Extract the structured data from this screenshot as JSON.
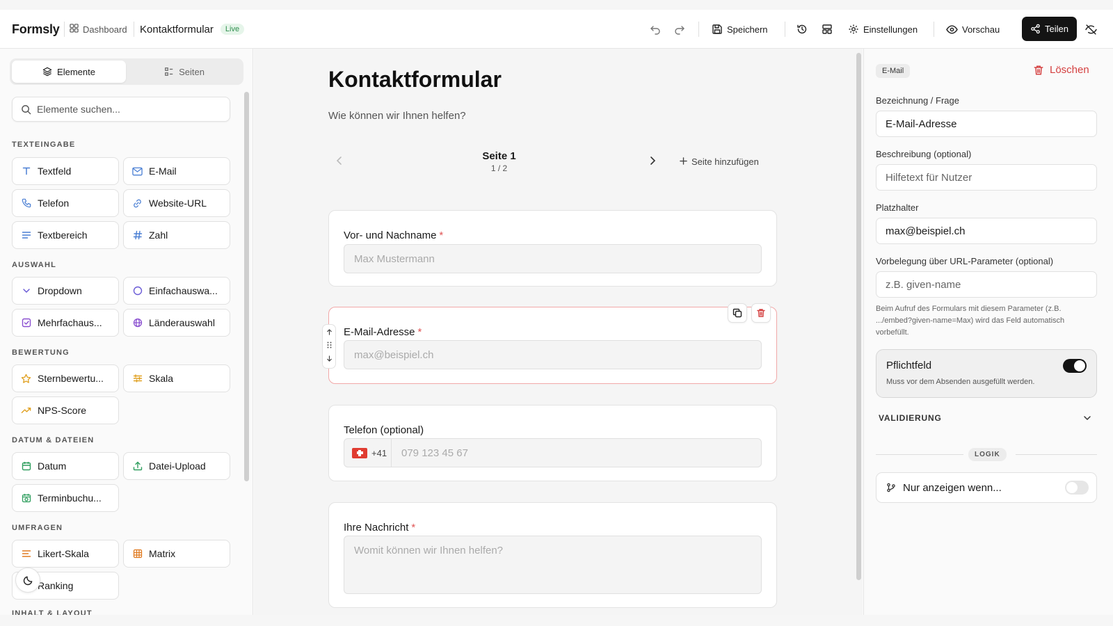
{
  "app": {
    "logo": "Formsly",
    "breadcrumb": "Dashboard",
    "form_name": "Kontaktformular",
    "status_badge": "Live",
    "save_label": "Speichern",
    "settings_label": "Einstellungen",
    "preview_label": "Vorschau",
    "share_label": "Teilen"
  },
  "sidebar": {
    "tabs": [
      {
        "label": "Elemente"
      },
      {
        "label": "Seiten"
      }
    ],
    "search_placeholder": "Elemente suchen...",
    "categories": [
      {
        "title": "TEXTEINGABE",
        "items": [
          {
            "label": "Textfeld",
            "icon": "text-icon"
          },
          {
            "label": "E-Mail",
            "icon": "mail-icon"
          },
          {
            "label": "Telefon",
            "icon": "phone-icon"
          },
          {
            "label": "Website-URL",
            "icon": "link-icon"
          },
          {
            "label": "Textbereich",
            "icon": "lines-icon"
          },
          {
            "label": "Zahl",
            "icon": "hash-icon"
          }
        ]
      },
      {
        "title": "AUSWAHL",
        "items": [
          {
            "label": "Dropdown",
            "icon": "chevron-down-icon"
          },
          {
            "label": "Einfachauswa...",
            "icon": "radio-icon"
          },
          {
            "label": "Mehrfachaus...",
            "icon": "checkbox-icon"
          },
          {
            "label": "Länderauswahl",
            "icon": "globe-icon"
          }
        ]
      },
      {
        "title": "BEWERTUNG",
        "items": [
          {
            "label": "Sternbewertu...",
            "icon": "star-icon"
          },
          {
            "label": "Skala",
            "icon": "sliders-icon"
          },
          {
            "label": "NPS-Score",
            "icon": "trend-icon"
          }
        ]
      },
      {
        "title": "DATUM & DATEIEN",
        "items": [
          {
            "label": "Datum",
            "icon": "calendar-icon"
          },
          {
            "label": "Datei-Upload",
            "icon": "upload-icon"
          },
          {
            "label": "Terminbuchu...",
            "icon": "calendar-clock-icon"
          }
        ]
      },
      {
        "title": "UMFRAGEN",
        "items": [
          {
            "label": "Likert-Skala",
            "icon": "list-icon"
          },
          {
            "label": "Matrix",
            "icon": "grid-icon"
          },
          {
            "label": "Ranking",
            "icon": "ranking-icon"
          }
        ]
      },
      {
        "title": "INHALT & LAYOUT",
        "items": []
      }
    ]
  },
  "canvas": {
    "title": "Kontaktformular",
    "subtitle": "Wie können wir Ihnen helfen?",
    "page_label": "Seite 1",
    "page_count": "1 / 2",
    "add_page": "Seite hinzufügen",
    "fields": [
      {
        "label": "Vor- und Nachname",
        "required": "*",
        "placeholder": "Max Mustermann"
      },
      {
        "label": "E-Mail-Adresse",
        "required": "*",
        "placeholder": "max@beispiel.ch"
      },
      {
        "label": "Telefon (optional)",
        "required": "",
        "prefix": "+41",
        "placeholder": "079 123 45 67"
      },
      {
        "label": "Ihre Nachricht",
        "required": "*",
        "placeholder": "Womit können wir Ihnen helfen?"
      }
    ]
  },
  "panel": {
    "type_chip": "E-Mail",
    "delete_label": "Löschen",
    "label_label": "Bezeichnung / Frage",
    "label_value": "E-Mail-Adresse",
    "desc_label": "Beschreibung (optional)",
    "desc_placeholder": "Hilfetext für Nutzer",
    "ph_label": "Platzhalter",
    "ph_value": "max@beispiel.ch",
    "prefill_label": "Vorbelegung über URL-Parameter (optional)",
    "prefill_placeholder": "z.B. given-name",
    "prefill_hint": "Beim Aufruf des Formulars mit diesem Parameter (z.B. .../embed?given-name=Max) wird das Feld automatisch vorbefüllt.",
    "required_title": "Pflichtfeld",
    "required_desc": "Muss vor dem Absenden ausgefüllt werden.",
    "required_on": true,
    "validation_label": "VALIDIERUNG",
    "logic_label": "LOGIK",
    "condition_label": "Nur anzeigen wenn...",
    "condition_on": false
  }
}
